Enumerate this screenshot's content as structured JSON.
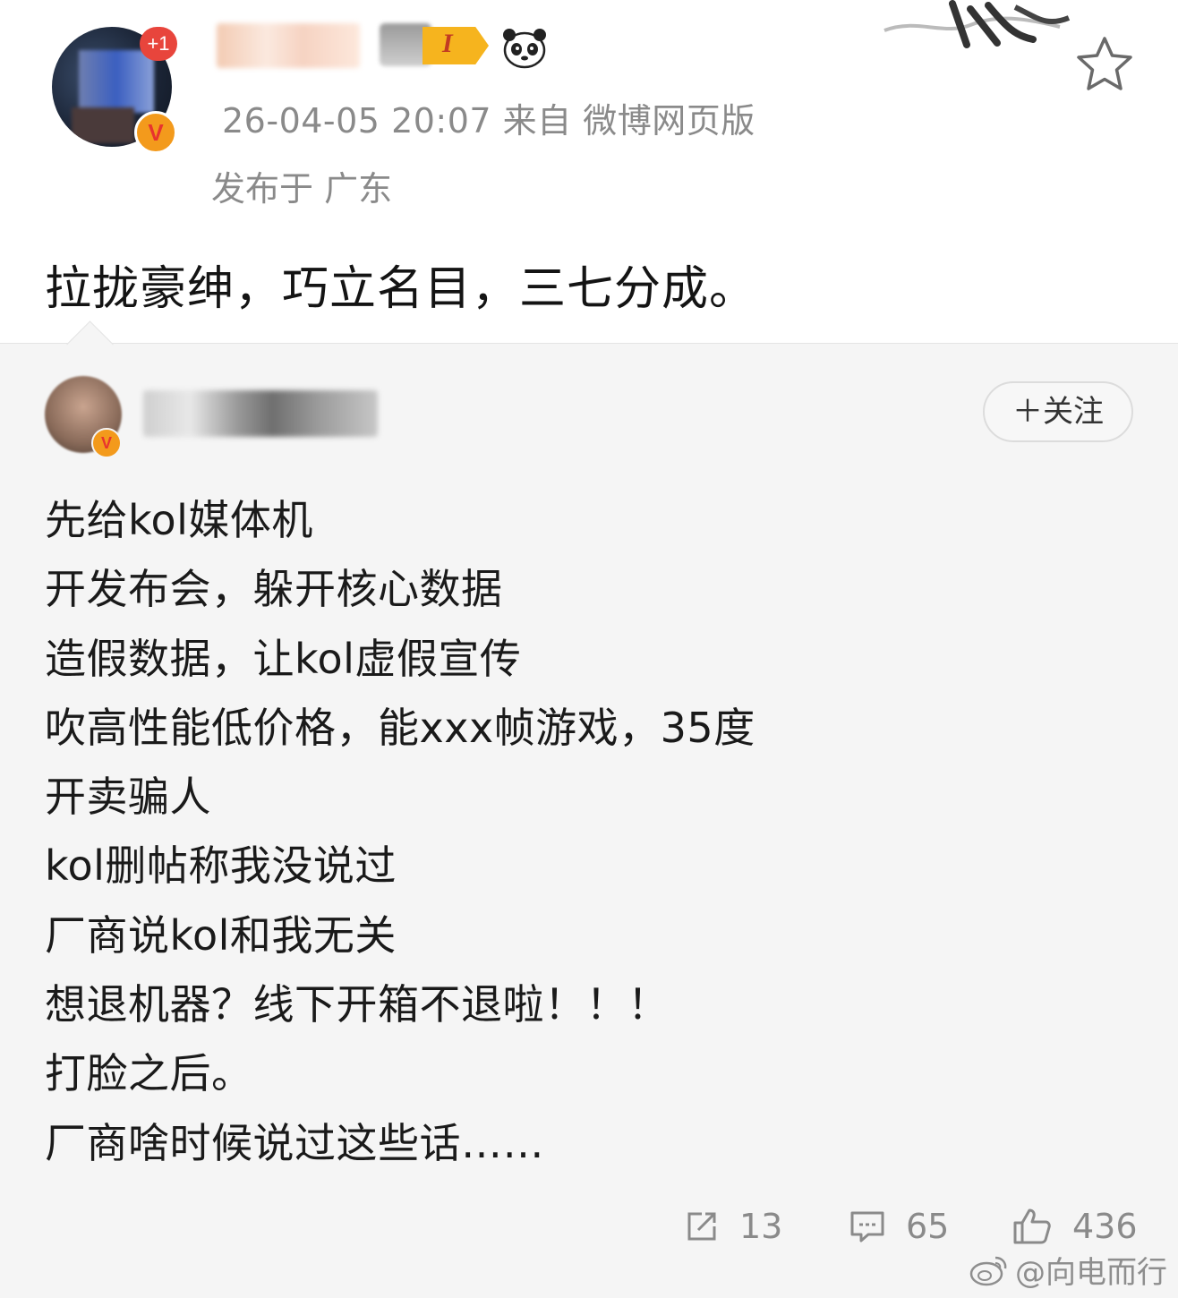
{
  "post": {
    "notification_count": "+1",
    "vip_level": "I",
    "timestamp_source": "26-04-05 20:07  来自 微博网页版",
    "location": "发布于 广东",
    "text": "拉拢豪绅，巧立名目，三七分成。",
    "icons": {
      "avatar": "avatar-blurred",
      "verified": "verified-v-icon",
      "vip": "vip-level-badge-icon",
      "panda": "panda-icon",
      "favorite": "star-icon"
    }
  },
  "quoted": {
    "follow_label": "＋关注",
    "lines": [
      "先给kol媒体机",
      "开发布会，躲开核心数据",
      "造假数据，让kol虚假宣传",
      "吹高性能低价格，能xxx帧游戏，35度",
      "开卖骗人",
      "kol删帖称我没说过",
      "厂商说kol和我无关",
      "想退机器？线下开箱不退啦！！！",
      "打脸之后。",
      "厂商啥时候说过这些话……"
    ],
    "actions": {
      "repost_count": "13",
      "comment_count": "65",
      "like_count": "436"
    }
  },
  "watermark": {
    "text": "@向电而行"
  },
  "colors": {
    "accent_orange": "#f39a1c",
    "badge_red": "#e8453c",
    "meta_gray": "#8a8a8a",
    "quote_bg": "#f5f5f5"
  }
}
